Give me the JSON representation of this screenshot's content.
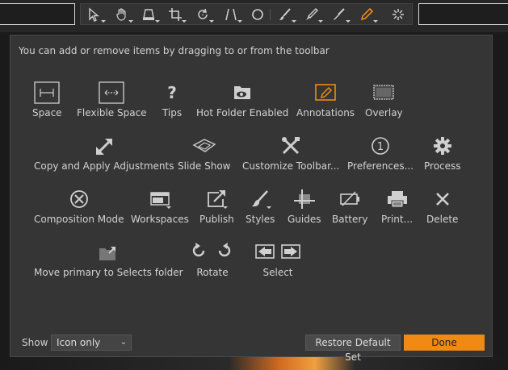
{
  "dialog": {
    "instructions": "You can add or remove items by dragging to or from the toolbar",
    "items": [
      {
        "label": "Space",
        "icon": "space-icon"
      },
      {
        "label": "Flexible Space",
        "icon": "flexible-space-icon"
      },
      {
        "label": "Tips",
        "icon": "question-mark-icon"
      },
      {
        "label": "Hot Folder Enabled",
        "icon": "hot-folder-eye-icon"
      },
      {
        "label": "Annotations",
        "icon": "annotations-pencil-icon"
      },
      {
        "label": "Overlay",
        "icon": "overlay-icon"
      },
      {
        "label": "Copy and Apply Adjustments",
        "icon": "copy-apply-arrows-icon"
      },
      {
        "label": "Slide Show",
        "icon": "slide-show-icon"
      },
      {
        "label": "Customize Toolbar...",
        "icon": "tools-crossed-icon"
      },
      {
        "label": "Preferences...",
        "icon": "preferences-circle-1-icon"
      },
      {
        "label": "Process",
        "icon": "gear-icon"
      },
      {
        "label": "Composition Mode",
        "icon": "composition-mode-x-circle-icon"
      },
      {
        "label": "Workspaces",
        "icon": "workspaces-icon"
      },
      {
        "label": "Publish",
        "icon": "publish-share-icon"
      },
      {
        "label": "Styles",
        "icon": "styles-brush-icon"
      },
      {
        "label": "Guides",
        "icon": "guides-icon"
      },
      {
        "label": "Battery",
        "icon": "battery-icon"
      },
      {
        "label": "Print...",
        "icon": "printer-icon"
      },
      {
        "label": "Delete",
        "icon": "delete-x-icon"
      },
      {
        "label": "Move primary to Selects folder",
        "icon": "move-to-selects-icon"
      },
      {
        "label": "Rotate",
        "icon": "rotate-arrows-icon"
      },
      {
        "label": "Select",
        "icon": "select-arrows-icon"
      }
    ],
    "show_label": "Show",
    "show_value": "Icon only",
    "restore_label": "Restore Default Set",
    "done_label": "Done"
  },
  "toolbar": {
    "tools": [
      "select-arrow-icon",
      "hand-pan-icon",
      "keystone-icon",
      "crop-icon",
      "rotate-straighten-icon",
      "keystone-lines-icon",
      "circle-mask-icon",
      "brush-icon",
      "eraser-pen-icon",
      "gradient-mask-icon",
      "annotation-pen-icon",
      "loading-spinner-icon"
    ],
    "active_tool": "annotation-pen-icon"
  },
  "colors": {
    "accent": "#f08a12",
    "panel": "#353535",
    "text": "#d2d2d2"
  }
}
